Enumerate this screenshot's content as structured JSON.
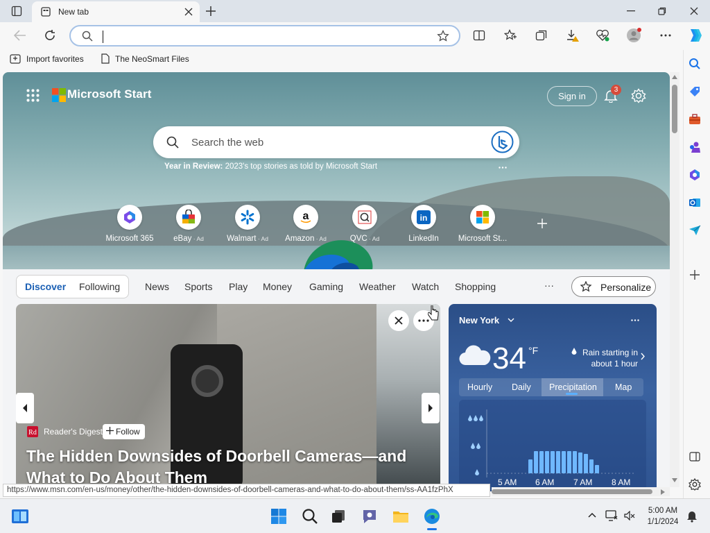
{
  "browser": {
    "tab": {
      "title": "New tab"
    },
    "address": {
      "value": "",
      "placeholder": ""
    },
    "favorites": [
      {
        "label": "Import favorites"
      },
      {
        "label": "The NeoSmart Files"
      }
    ]
  },
  "start": {
    "brand": "Microsoft Start",
    "sign_in": "Sign in",
    "notification_count": "3",
    "search_placeholder": "Search the web",
    "year_in_review": {
      "bold": "Year in Review:",
      "text": " 2023's top stories as told by Microsoft Start"
    },
    "quick_links": [
      {
        "label": "Microsoft 365",
        "ad": ""
      },
      {
        "label": "eBay",
        "ad": " · Ad"
      },
      {
        "label": "Walmart",
        "ad": " · Ad"
      },
      {
        "label": "Amazon",
        "ad": " · Ad"
      },
      {
        "label": "QVC",
        "ad": " · Ad"
      },
      {
        "label": "LinkedIn",
        "ad": ""
      },
      {
        "label": "Microsoft St...",
        "ad": ""
      }
    ]
  },
  "feed": {
    "tabs": [
      "Discover",
      "Following",
      "News",
      "Sports",
      "Play",
      "Money",
      "Gaming",
      "Weather",
      "Watch",
      "Shopping"
    ],
    "more": "···",
    "personalize": "Personalize",
    "hero": {
      "source": "Reader's Digest",
      "follow": "Follow",
      "headline": "The Hidden Downsides of Doorbell Cameras—and What to Do About Them"
    },
    "weather": {
      "city": "New York",
      "temp": "34",
      "unit": "°F",
      "forecast": "Rain starting in about 1 hour",
      "tabs": [
        "Hourly",
        "Daily",
        "Precipitation",
        "Map"
      ],
      "active_tab": "Precipitation",
      "times": [
        "5 AM",
        "6 AM",
        "7 AM",
        "8 AM"
      ],
      "precip_bars": [
        0.5,
        0.8,
        0.8,
        0.8,
        0.8,
        0.8,
        0.8,
        0.8,
        0.8,
        0.75,
        0.7,
        0.5,
        0.3
      ]
    }
  },
  "status_url": "https://www.msn.com/en-us/money/other/the-hidden-downsides-of-doorbell-cameras-and-what-to-do-about-them/ss-AA1fzPhX",
  "taskbar": {
    "time": "5:00 AM",
    "date": "1/1/2024"
  }
}
